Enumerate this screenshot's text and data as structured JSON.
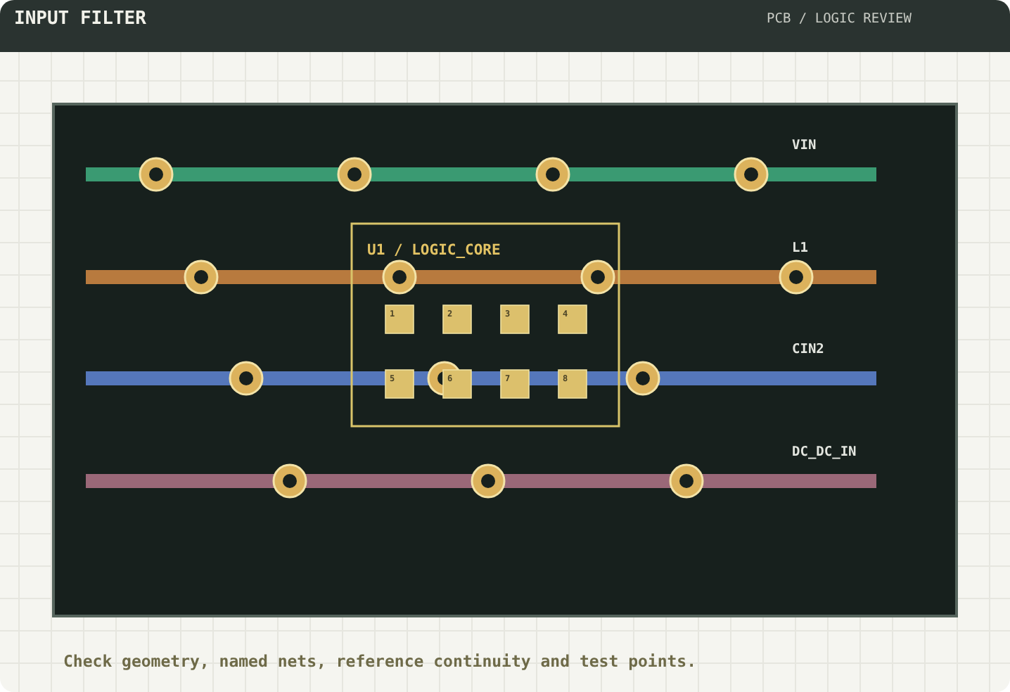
{
  "header": {
    "title": "INPUT FILTER",
    "subtitle": "PCB / LOGIC REVIEW"
  },
  "nets": [
    {
      "name": "VIN",
      "color": "#3a9a72"
    },
    {
      "name": "L1",
      "color": "#b87a3e"
    },
    {
      "name": "CIN2",
      "color": "#5577bb"
    },
    {
      "name": "DC_DC_IN",
      "color": "#9a6878"
    }
  ],
  "chip": {
    "label": "U1 / LOGIC_CORE",
    "pins": [
      "1",
      "2",
      "3",
      "4",
      "5",
      "6",
      "7",
      "8"
    ]
  },
  "caption": "Check geometry, named nets, reference continuity and test points."
}
